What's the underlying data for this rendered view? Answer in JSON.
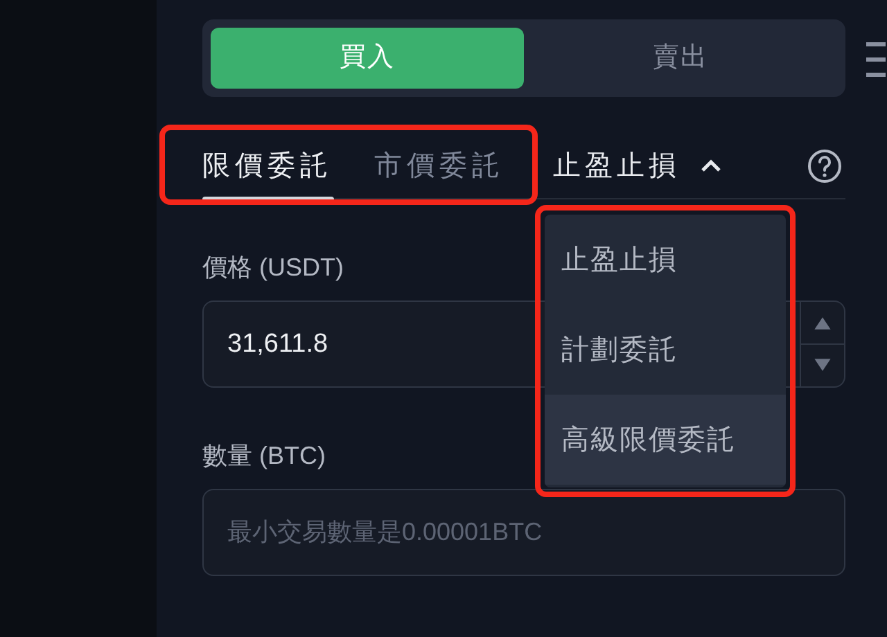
{
  "side_toggle": [
    {
      "label": "買入",
      "selected": true
    },
    {
      "label": "賣出",
      "selected": false
    }
  ],
  "order_tabs": {
    "framed": true,
    "items": [
      {
        "label": "限價委託",
        "selected": true
      },
      {
        "label": "市價委託",
        "selected": false
      }
    ]
  },
  "order_type_dropdown": {
    "label": "止盈止損",
    "expanded": true,
    "menu_framed": true,
    "options": [
      {
        "label": "止盈止損",
        "highlighted": false
      },
      {
        "label": "計劃委託",
        "highlighted": false
      },
      {
        "label": "高級限價委託",
        "highlighted": true
      }
    ]
  },
  "price": {
    "label": "價格 (USDT)",
    "value": "31,611.8"
  },
  "quantity": {
    "label": "數量 (BTC)",
    "placeholder": "最小交易數量是0.00001BTC"
  }
}
